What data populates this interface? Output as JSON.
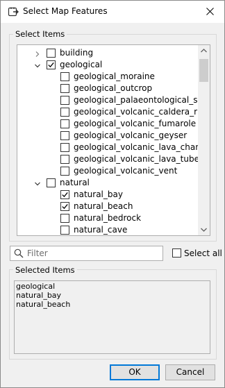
{
  "window": {
    "title": "Select Map Features",
    "app_icon": "select-features-icon",
    "close_icon": "close-icon"
  },
  "select_items": {
    "group_label": "Select Items",
    "tree": [
      {
        "label": "building",
        "level": 0,
        "expander": "collapsed",
        "checked": false
      },
      {
        "label": "geological",
        "level": 0,
        "expander": "expanded",
        "checked": true
      },
      {
        "label": "geological_moraine",
        "level": 1,
        "expander": "none",
        "checked": false
      },
      {
        "label": "geological_outcrop",
        "level": 1,
        "expander": "none",
        "checked": false
      },
      {
        "label": "geological_palaeontological_site",
        "level": 1,
        "expander": "none",
        "checked": false
      },
      {
        "label": "geological_volcanic_caldera_rim",
        "level": 1,
        "expander": "none",
        "checked": false
      },
      {
        "label": "geological_volcanic_fumarole",
        "level": 1,
        "expander": "none",
        "checked": false
      },
      {
        "label": "geological_volcanic_geyser",
        "level": 1,
        "expander": "none",
        "checked": false
      },
      {
        "label": "geological_volcanic_lava_chan…",
        "level": 1,
        "expander": "none",
        "checked": false
      },
      {
        "label": "geological_volcanic_lava_tube",
        "level": 1,
        "expander": "none",
        "checked": false
      },
      {
        "label": "geological_volcanic_vent",
        "level": 1,
        "expander": "none",
        "checked": false
      },
      {
        "label": "natural",
        "level": 0,
        "expander": "expanded",
        "checked": false
      },
      {
        "label": "natural_bay",
        "level": 1,
        "expander": "none",
        "checked": true
      },
      {
        "label": "natural_beach",
        "level": 1,
        "expander": "none",
        "checked": true
      },
      {
        "label": "natural_bedrock",
        "level": 1,
        "expander": "none",
        "checked": false
      },
      {
        "label": "natural_cave",
        "level": 1,
        "expander": "none",
        "checked": false
      }
    ]
  },
  "filter": {
    "placeholder": "Filter",
    "value": "",
    "icon": "search-icon"
  },
  "select_all": {
    "label": "Select all",
    "checked": false
  },
  "selected_items": {
    "group_label": "Selected Items",
    "items": [
      "geological",
      "natural_bay",
      "natural_beach"
    ]
  },
  "buttons": {
    "ok_label": "OK",
    "cancel_label": "Cancel"
  },
  "colors": {
    "dialog_bg": "#f0f0f0",
    "accent": "#0078d7"
  }
}
